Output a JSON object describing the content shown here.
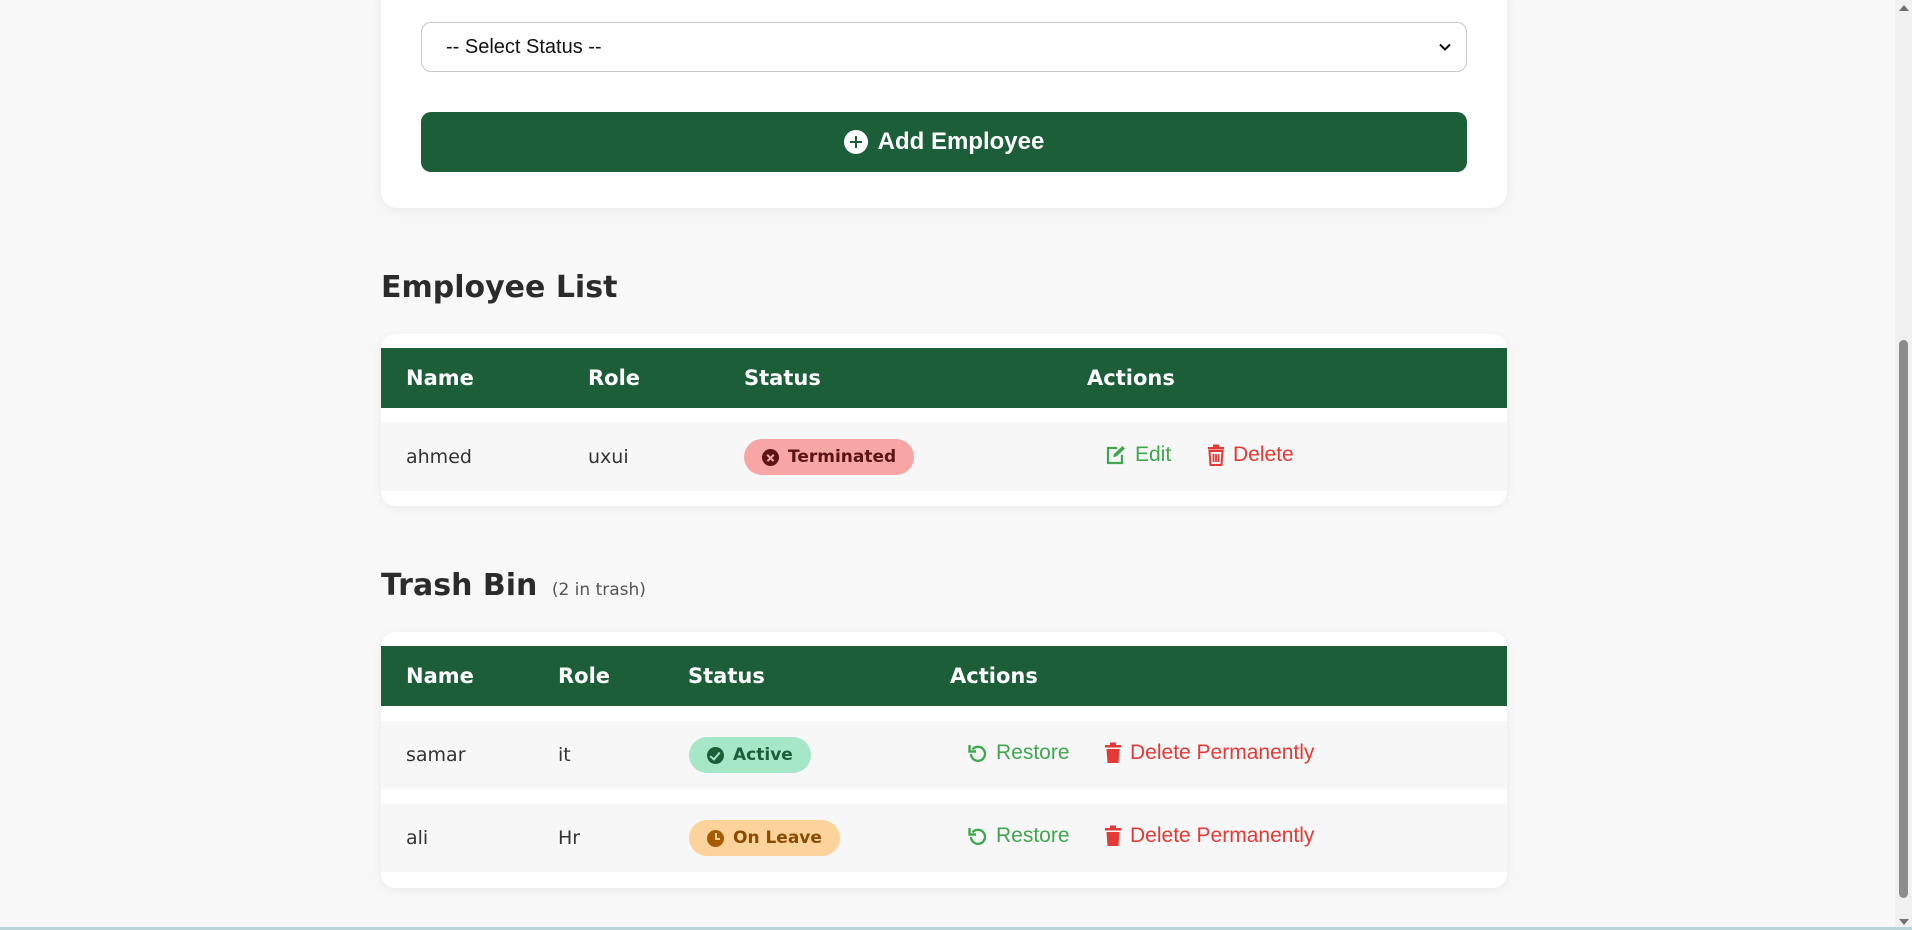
{
  "form": {
    "status_select_value": "-- Select Status --",
    "add_button_label": "Add Employee"
  },
  "employee_list": {
    "title": "Employee List",
    "columns": [
      "Name",
      "Role",
      "Status",
      "Actions"
    ],
    "rows": [
      {
        "name": "ahmed",
        "role": "uxui",
        "status": "Terminated",
        "edit_label": "Edit",
        "delete_label": "Delete"
      }
    ]
  },
  "trash_bin": {
    "title": "Trash Bin",
    "count_text": "(2 in trash)",
    "columns": [
      "Name",
      "Role",
      "Status",
      "Actions"
    ],
    "rows": [
      {
        "name": "samar",
        "role": "it",
        "status": "Active",
        "restore_label": "Restore",
        "delete_label": "Delete Permanently"
      },
      {
        "name": "ali",
        "role": "Hr",
        "status": "On Leave",
        "restore_label": "Restore",
        "delete_label": "Delete Permanently"
      }
    ]
  },
  "colors": {
    "primary_green": "#1b5e37",
    "action_green": "#3fa84f",
    "action_red": "#e53935",
    "terminated_bg": "#f8a5a5",
    "active_bg": "#a6e7c8",
    "on_leave_bg": "#fdd39c"
  },
  "icons": {
    "add_button": "plus-circle-icon",
    "edit": "edit-icon",
    "delete": "trash-icon",
    "restore": "undo-icon",
    "terminated": "x-circle-icon",
    "active": "check-circle-icon",
    "on_leave": "clock-icon"
  }
}
